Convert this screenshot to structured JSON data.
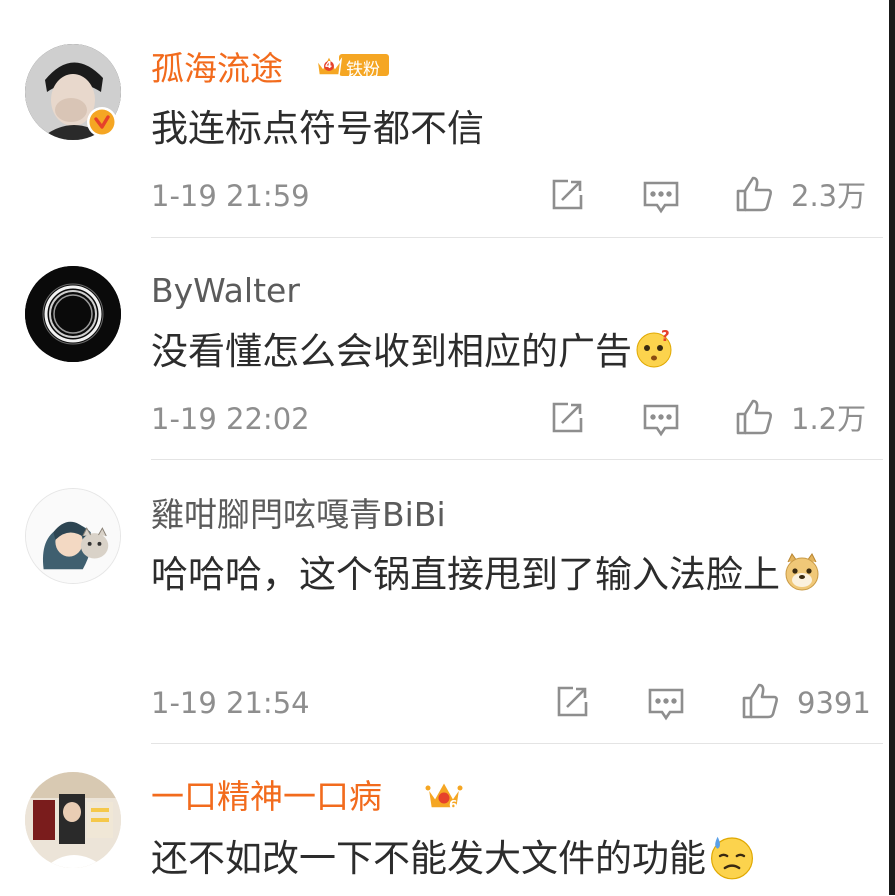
{
  "comments": [
    {
      "username": "孤海流途",
      "badge_label": "铁粉",
      "badge_level": "4",
      "text": "我连标点符号都不信",
      "time": "1-19 21:59",
      "likes": "2.3万"
    },
    {
      "username": "ByWalter",
      "text": "没看懂怎么会收到相应的广告",
      "emoji": "confused-face-emoji",
      "time": "1-19 22:02",
      "likes": "1.2万"
    },
    {
      "username": "雞咁腳閂呟嘎青BiBi",
      "text": "哈哈哈，这个锅直接甩到了输入法脸上",
      "emoji": "doge-emoji",
      "time": "1-19 21:54",
      "likes": "9391"
    },
    {
      "username": "一口精神一口病",
      "badge_level": "6",
      "text": "还不如改一下不能发大文件的功能",
      "emoji": "sweat-face-emoji"
    }
  ],
  "colors": {
    "vip_name": "#f26b1d",
    "normal_name": "#5b5b5b",
    "meta": "#8e8e8e",
    "badge_gold": "#f5a623",
    "verified_red": "#e6412a"
  },
  "icons": [
    "repost-icon",
    "comment-icon",
    "like-icon",
    "verified-badge-icon",
    "crown-icon"
  ]
}
